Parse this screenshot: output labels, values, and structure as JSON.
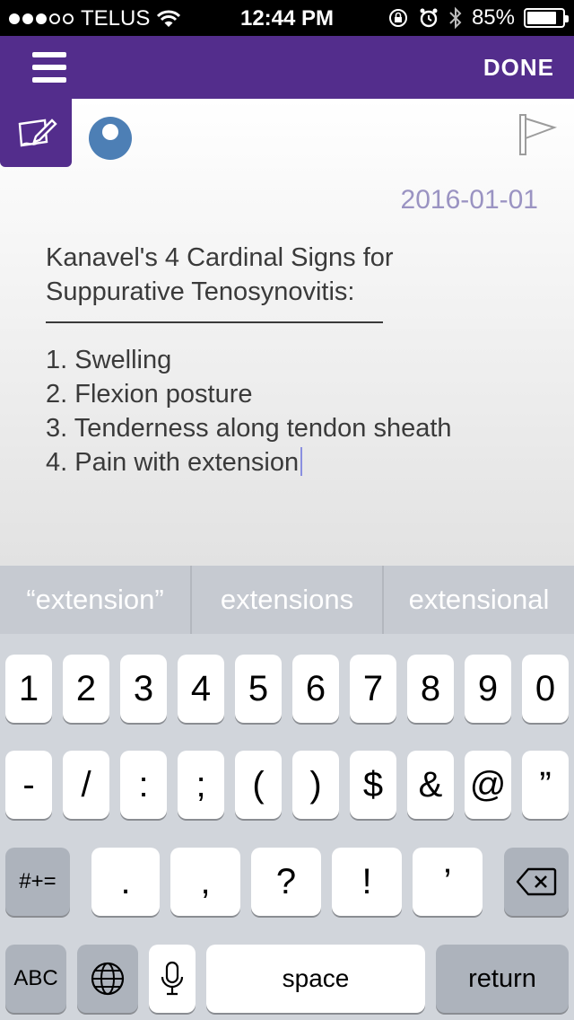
{
  "status_bar": {
    "carrier": "TELUS",
    "time": "12:44 PM",
    "battery": "85%",
    "battery_level": 0.85
  },
  "nav": {
    "done_label": "DONE"
  },
  "note": {
    "date": "2016-01-01",
    "title_line1": "Kanavel's 4 Cardinal Signs for",
    "title_line2": "Suppurative Tenosynovitis:",
    "items": [
      "1. Swelling",
      "2. Flexion posture",
      "3. Tenderness along tendon sheath",
      "4. Pain with extension"
    ]
  },
  "keyboard": {
    "suggestions": [
      "“extension”",
      "extensions",
      "extensional"
    ],
    "row1": [
      "1",
      "2",
      "3",
      "4",
      "5",
      "6",
      "7",
      "8",
      "9",
      "0"
    ],
    "row2": [
      "-",
      "/",
      ":",
      ";",
      "(",
      ")",
      "$",
      "&",
      "@",
      "”"
    ],
    "row3": [
      ".",
      ",",
      "?",
      "!",
      "’"
    ],
    "symbols_label": "#+=",
    "abc_label": "ABC",
    "space_label": "space",
    "return_label": "return"
  },
  "colors": {
    "brand_purple": "#532d8c",
    "date_color": "#9a93c2",
    "avatar_blue": "#4d7fb5"
  }
}
